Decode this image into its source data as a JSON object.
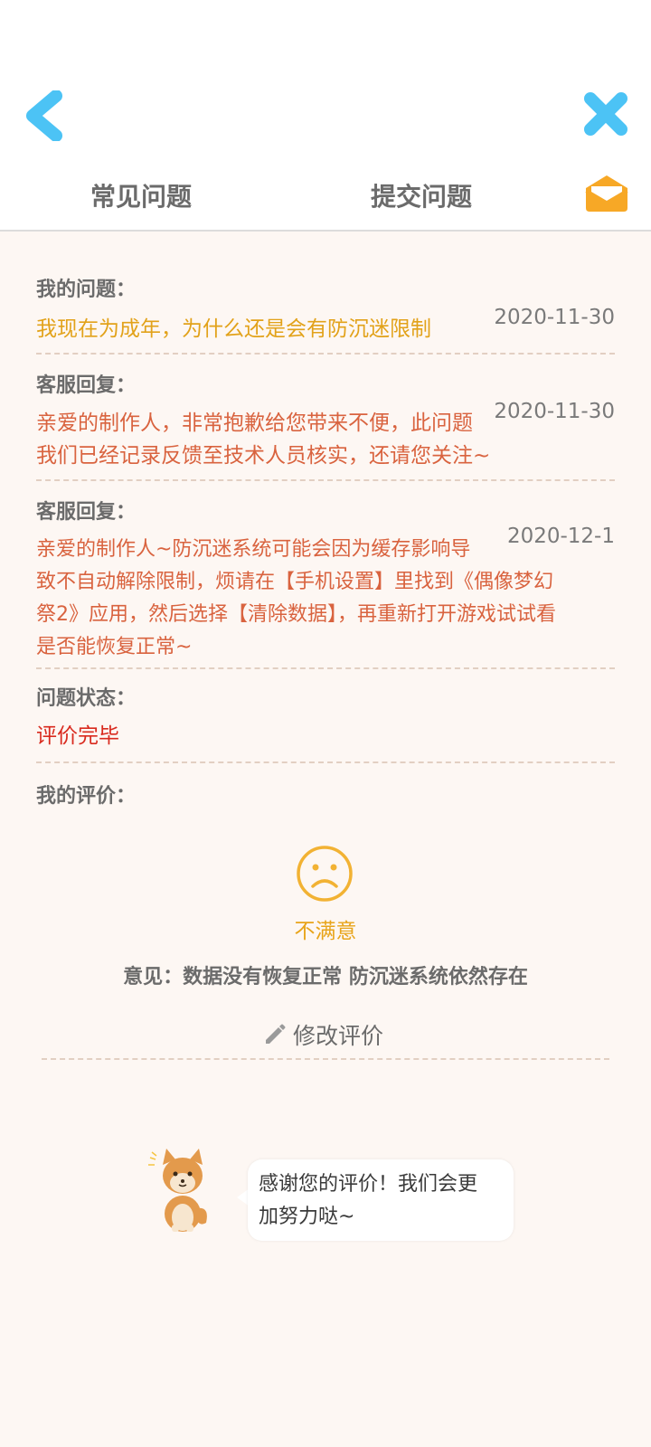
{
  "header": {
    "tabs": [
      {
        "label": "常见问题"
      },
      {
        "label": "提交问题"
      }
    ]
  },
  "my_question": {
    "label": "我的问题：",
    "date": "2020-11-30",
    "text": "我现在为成年，为什么还是会有防沉迷限制"
  },
  "replies": [
    {
      "label": "客服回复：",
      "date": "2020-11-30",
      "lines": [
        "亲爱的制作人，非常抱歉给您带来不便，此问题",
        "我们已经记录反馈至技术人员核实，还请您关注~"
      ]
    },
    {
      "label": "客服回复：",
      "date": "2020-12-1",
      "lines": [
        "亲爱的制作人~防沉迷系统可能会因为缓存影响导",
        "致不自动解除限制，烦请在【手机设置】里找到《偶像梦幻",
        "祭2》应用，然后选择【清除数据】，再重新打开游戏试试看",
        "是否能恢复正常~"
      ]
    }
  ],
  "status": {
    "label": "问题状态：",
    "value": "评价完毕"
  },
  "rating": {
    "label": "我的评价：",
    "face_icon": "sad-face-icon",
    "face_label": "不满意",
    "opinion": "意见：数据没有恢复正常 防沉迷系统依然存在",
    "edit_label": "修改评价"
  },
  "bubble": {
    "lines": [
      "感谢您的评价！我们会更",
      "加努力哒~"
    ]
  },
  "colors": {
    "accent_blue": "#4cc3f5",
    "accent_orange": "#f7a826",
    "question_text": "#e2a21a",
    "reply_text": "#d9633f",
    "status_text": "#d92a1e"
  }
}
